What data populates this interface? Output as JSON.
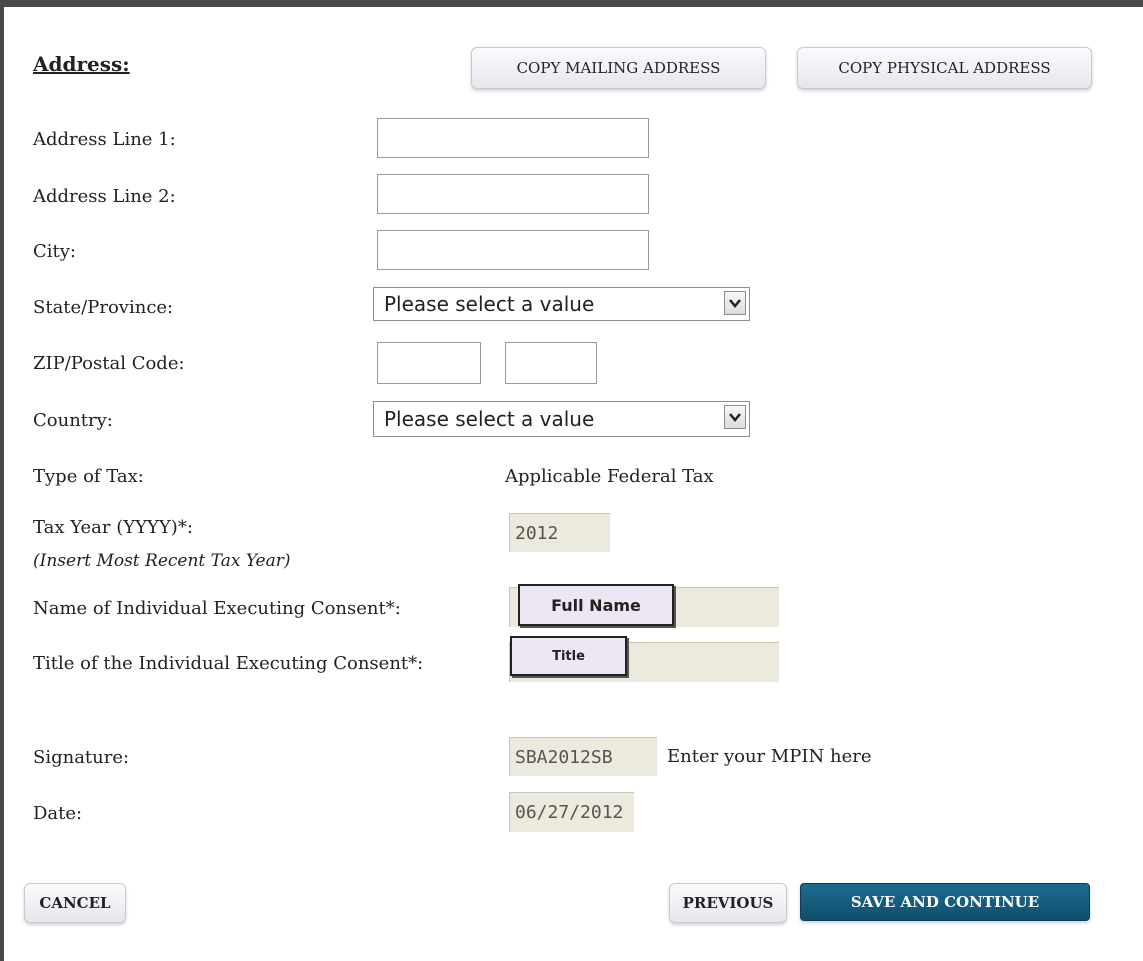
{
  "section": {
    "heading": "Address:"
  },
  "buttons": {
    "copy_mailing": "COPY MAILING ADDRESS",
    "copy_physical": "COPY PHYSICAL ADDRESS",
    "cancel": "CANCEL",
    "previous": "PREVIOUS",
    "save_continue": "SAVE AND CONTINUE"
  },
  "fields": {
    "address1": {
      "label": "Address Line 1:",
      "value": ""
    },
    "address2": {
      "label": "Address Line 2:",
      "value": ""
    },
    "city": {
      "label": "City:",
      "value": ""
    },
    "state": {
      "label": "State/Province:",
      "selected": "Please select a value"
    },
    "zip": {
      "label": "ZIP/Postal Code:",
      "value1": "",
      "value2": ""
    },
    "country": {
      "label": "Country:",
      "selected": "Please select a value"
    },
    "tax_type": {
      "label": "Type of Tax:",
      "value": "Applicable Federal Tax"
    },
    "tax_year": {
      "label": "Tax Year (YYYY)*:",
      "hint": "(Insert Most Recent Tax Year)",
      "value": "2012"
    },
    "name": {
      "label": "Name of Individual Executing Consent*:",
      "callout": "Full Name"
    },
    "title": {
      "label": "Title of the Individual Executing Consent*:",
      "callout": "Title"
    },
    "signature": {
      "label": "Signature:",
      "value": "SBA2012SB",
      "note": "Enter your MPIN here"
    },
    "date": {
      "label": "Date:",
      "value": "06/27/2012"
    }
  },
  "colors": {
    "primary_button": "#0f4e6c",
    "readonly_bg": "#ece9dd",
    "callout_bg": "#ece7f2"
  },
  "icons": {
    "dropdown": "chevron-down-icon"
  }
}
